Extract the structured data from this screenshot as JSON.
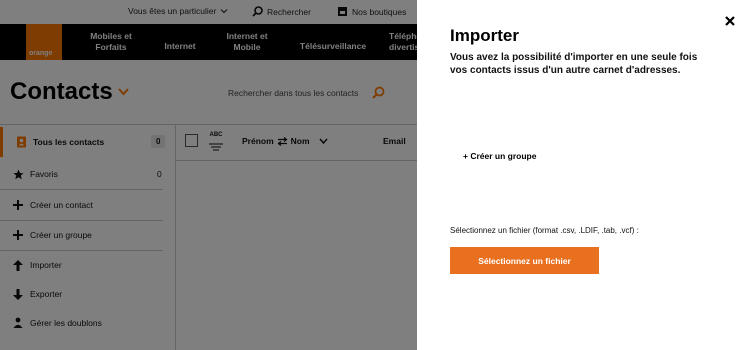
{
  "topbar": {
    "customer_type": "Vous êtes un particulier",
    "search": "Rechercher",
    "stores": "Nos boutiques"
  },
  "brand": {
    "logo_text": "orange",
    "color": "#ff7900"
  },
  "nav": {
    "items": [
      "Mobiles et\nForfaits",
      "Internet",
      "Internet et\nMobile",
      "Télésurveillance",
      "Téléphone\ndivertissement"
    ]
  },
  "contacts": {
    "title": "Contacts",
    "search_placeholder": "Rechercher dans tous les contacts"
  },
  "sidebar": {
    "items": [
      {
        "label": "Tous les contacts",
        "count": "0",
        "icon": "contact-book-icon"
      },
      {
        "label": "Favoris",
        "count": "0",
        "icon": "star-icon"
      },
      {
        "label": "Créer un contact",
        "icon": "plus-icon"
      },
      {
        "label": "Créer un groupe",
        "icon": "plus-icon"
      },
      {
        "label": "Importer",
        "icon": "arrow-up-icon"
      },
      {
        "label": "Exporter",
        "icon": "arrow-down-icon"
      },
      {
        "label": "Gérer les doublons",
        "icon": "users-icon"
      }
    ]
  },
  "table": {
    "sort_label": "ABC",
    "col_firstname": "Prénom",
    "col_name": "Nom",
    "col_email": "Email"
  },
  "panel": {
    "title": "Importer",
    "description": "Vous avez la possibilité d'importer en une seule fois vos contacts issus d'un autre carnet d'adresses.",
    "create_group": "+ Créer un groupe",
    "select_label": "Sélectionnez un fichier (format .csv, .LDIF, .tab, .vcf) :",
    "select_button": "Sélectionnez un fichier",
    "accent": "#e9701f"
  }
}
